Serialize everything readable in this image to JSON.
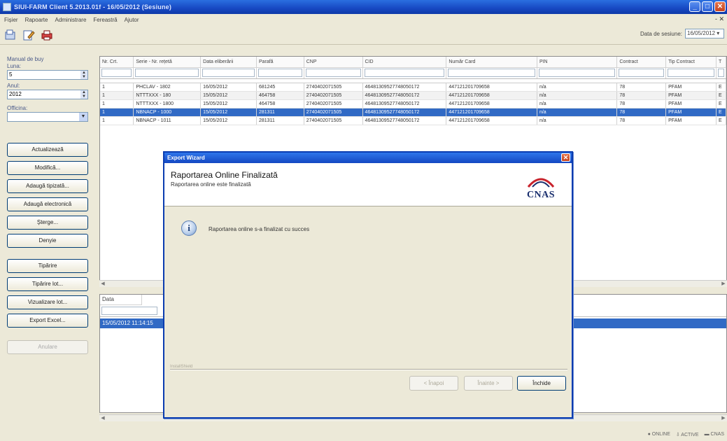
{
  "window": {
    "title": "SIUI-FARM Client 5.2013.01f - 16/05/2012 (Sesiune)",
    "min_glyph": "_",
    "max_glyph": "□",
    "close_glyph": "✕"
  },
  "menu": {
    "items": [
      "Fișier",
      "Rapoarte",
      "Administrare",
      "Fereastră",
      "Ajutor"
    ],
    "right": "- ✕"
  },
  "toolbar": {
    "icons": [
      "open-icon",
      "edit-icon",
      "print-icon"
    ],
    "session_label": "Data de sesiune:",
    "session_value": "16/05/2012 ▾"
  },
  "left": {
    "group_label": "Manual de buy",
    "luna_label": "Luna:",
    "luna_value": "5",
    "anul_label": "Anul:",
    "anul_value": "2012",
    "officina_label": "Officina:",
    "officina_value": "",
    "buttons": [
      "Actualizează",
      "Modifică...",
      "Adaugă tipizată...",
      "Adaugă electronică",
      "Șterge...",
      "Denyie",
      "Tipărire",
      "Tipărire lot...",
      "Vizualizare lot...",
      "Export Excel...",
      "Anulare"
    ]
  },
  "grid": {
    "columns": [
      "Nr. Crt.",
      "Serie - Nr. rețetă",
      "Data eliberării",
      "Parafă",
      "CNP",
      "CID",
      "Număr Card",
      "PIN",
      "Contract",
      "Tip Contract",
      "T"
    ],
    "rows": [
      [
        "1",
        "PHCLAV - 1802",
        "16/05/2012",
        "681245",
        "2740402071505",
        "46481309527748050172",
        "447121201709658",
        "n/a",
        "78",
        "PFAM",
        "E"
      ],
      [
        "1",
        "NTTTXXX - 180",
        "15/05/2012",
        "464758",
        "2740402071505",
        "46481309527748050172",
        "447121201709658",
        "n/a",
        "78",
        "PFAM",
        "E"
      ],
      [
        "1",
        "NTTTXXX - 1800",
        "15/05/2012",
        "464758",
        "2740402071505",
        "46481309527748050172",
        "447121201709658",
        "n/a",
        "78",
        "PFAM",
        "E"
      ],
      [
        "1",
        "NBNACP - 1000",
        "15/05/2012",
        "281311",
        "2740402071505",
        "46481309527748050172",
        "447121201709658",
        "n/a",
        "78",
        "PFAM",
        "E"
      ],
      [
        "1",
        "NBNACP - 1011",
        "15/05/2012",
        "281311",
        "2740402071505",
        "46481309527748050172",
        "447121201709658",
        "n/a",
        "78",
        "PFAM",
        "E"
      ]
    ],
    "selected_row": 3
  },
  "grid2": {
    "column": "Data",
    "row": "15/05/2012 11:14:15"
  },
  "status": {
    "items": [
      "● ONLINE",
      "⇩ ACTIVE",
      "▬ CNAS"
    ]
  },
  "dialog": {
    "title": "Export Wizard",
    "close_glyph": "✕",
    "heading": "Raportarea Online Finalizată",
    "subheading": "Raportarea online este finalizată",
    "logo_text": "CNAS",
    "info_glyph": "i",
    "message": "Raportarea online s-a finalizat cu succes",
    "footer_label": "InstallShield",
    "back_label": "< Înapoi",
    "next_label": "Înainte >",
    "finish_label": "Închide"
  }
}
